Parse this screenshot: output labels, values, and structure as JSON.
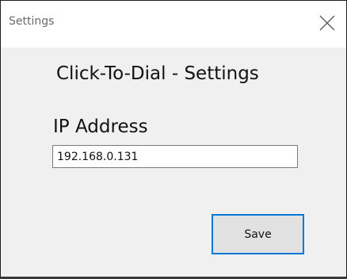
{
  "window": {
    "title": "Settings"
  },
  "dialog": {
    "heading": "Click-To-Dial - Settings",
    "ip_label": "IP Address",
    "ip_value": "192.168.0.131",
    "save_label": "Save"
  },
  "icons": {
    "close": "close-icon"
  },
  "colors": {
    "titlebar_bg": "#ffffff",
    "body_bg": "#f0f0f0",
    "button_bg": "#e1e1e1",
    "button_focus_border": "#0078d7",
    "title_text": "#6a6a6a"
  }
}
